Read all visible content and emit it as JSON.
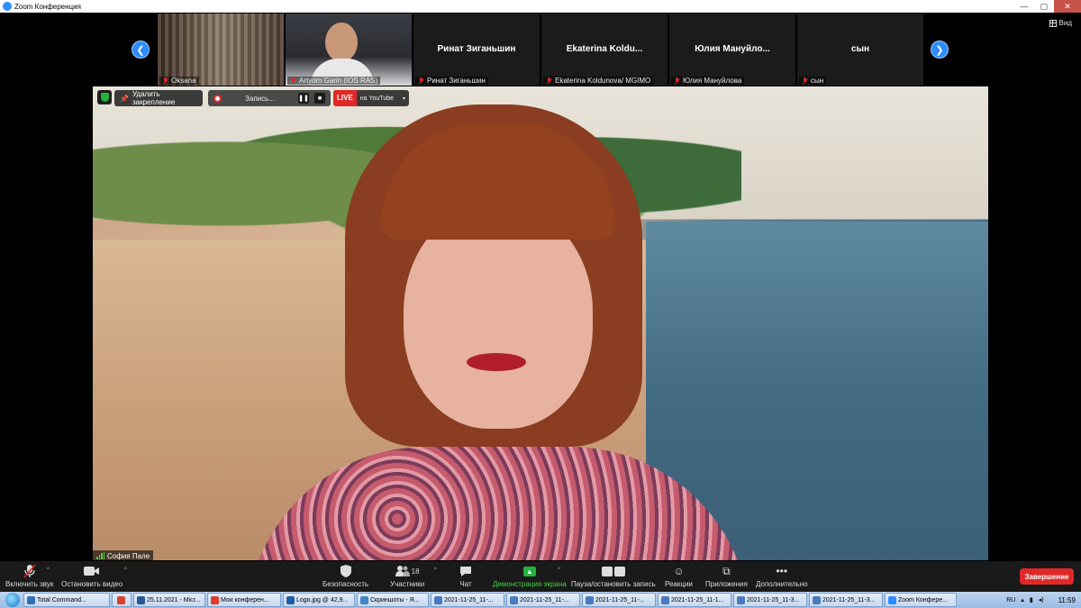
{
  "titlebar": {
    "title": "Zoom Конференция",
    "minimize_icon": "minimize-icon",
    "maximize_icon": "maximize-icon",
    "close_icon": "close-icon"
  },
  "strip": {
    "view_label": "Вид",
    "prev_icon": "chevron-left-icon",
    "next_icon": "chevron-right-icon",
    "tiles": [
      {
        "title": "",
        "name": "Oksana",
        "video": true
      },
      {
        "title": "",
        "name": "Artyom Garin (IOS RAS)",
        "video": true
      },
      {
        "title": "Ринат Зиганьшин",
        "name": "Ринат Зиганьшин",
        "video": false
      },
      {
        "title": "Ekaterina  Koldu...",
        "name": "Ekaterina Koldunova/ MGIMO",
        "video": false
      },
      {
        "title": "Юлия  Мануйло...",
        "name": "Юлия Мануйлова",
        "video": false
      },
      {
        "title": "сын",
        "name": "сын",
        "video": false
      }
    ]
  },
  "video_overlay": {
    "unpin_label": "Удалить закрепление",
    "recording_label": "Запись...",
    "pause_glyph": "❚❚",
    "stop_glyph": "■",
    "live_badge": "LIVE",
    "live_target": "на YouTube",
    "live_caret": "▾"
  },
  "speaker": {
    "name": "София Пале"
  },
  "toolbar": {
    "mic_label": "Включить звук",
    "video_label": "Остановить видео",
    "security_label": "Безопасность",
    "participants_label": "Участники",
    "participants_count": "18",
    "chat_label": "Чат",
    "share_label": "Демонстрация экрана",
    "record_label": "Пауза/остановить запись",
    "reactions_label": "Реакции",
    "apps_label": "Приложения",
    "more_label": "Дополнительно",
    "end_label": "Завершение",
    "caret": "^"
  },
  "taskbar": {
    "items": [
      {
        "label": "Total Command...",
        "color": "#2f6fb8"
      },
      {
        "label": "",
        "color": "#d8452f"
      },
      {
        "label": "25.11.2021 - Micr...",
        "color": "#2b5797"
      },
      {
        "label": "Мои конферен...",
        "color": "#e03a2f"
      },
      {
        "label": "Logo.jpg @ 42,9...",
        "color": "#1d5fa8"
      },
      {
        "label": "Скриншоты - Я...",
        "color": "#3e86c8"
      },
      {
        "label": "2021-11-25_11-...",
        "color": "#4a7bbf"
      },
      {
        "label": "2021-11-25_11-...",
        "color": "#4a7bbf"
      },
      {
        "label": "2021-11-25_11-...",
        "color": "#4a7bbf"
      },
      {
        "label": "2021-11-25_11-1...",
        "color": "#4a7bbf"
      },
      {
        "label": "2021-11-25_11-3...",
        "color": "#4a7bbf"
      },
      {
        "label": "2021-11-25_11-3...",
        "color": "#4a7bbf"
      },
      {
        "label": "Zoom Конфере...",
        "color": "#2d8cff"
      }
    ],
    "language": "RU",
    "clock": "11:59"
  },
  "colors": {
    "accent": "#2d8cff",
    "end_red": "#e02828",
    "share_green": "#23b33c"
  }
}
